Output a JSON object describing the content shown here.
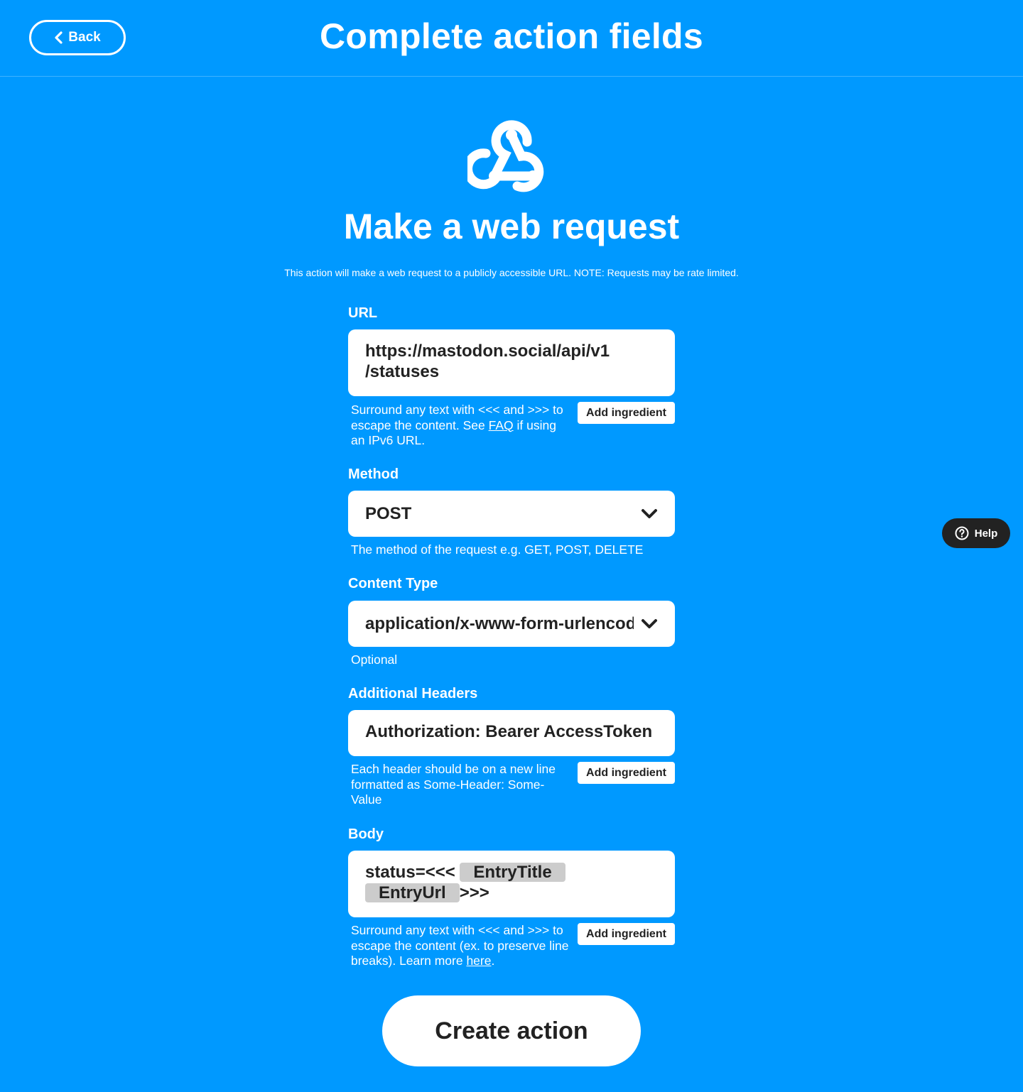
{
  "header": {
    "back_label": "Back",
    "title": "Complete action fields"
  },
  "service": {
    "icon": "webhooks-icon",
    "title": "Make a web request",
    "description": "This action will make a web request to a publicly accessible URL. NOTE: Requests may be rate limited."
  },
  "fields": {
    "url": {
      "label": "URL",
      "value_line1": "https://mastodon.social/api/v1",
      "value_line2": "/statuses",
      "help_part1": "Surround any text with <<< and >>> to escape the content. See ",
      "help_link": "FAQ",
      "help_part2": " if using an IPv6 URL.",
      "add_ingredient_label": "Add ingredient"
    },
    "method": {
      "label": "Method",
      "value": "POST",
      "help": "The method of the request e.g. GET, POST, DELETE"
    },
    "content_type": {
      "label": "Content Type",
      "value": "application/x-www-form-urlencoded",
      "help": "Optional"
    },
    "headers": {
      "label": "Additional Headers",
      "value": "Authorization: Bearer AccessToken",
      "help": "Each header should be on a new line formatted as Some-Header: Some-Value",
      "add_ingredient_label": "Add ingredient"
    },
    "body": {
      "label": "Body",
      "prefix": "status=<<< ",
      "ingredient1": "EntryTitle",
      "ingredient2": "EntryUrl",
      "suffix": ">>>",
      "help_part1": "Surround any text with <<< and >>> to escape the content (ex. to preserve line breaks). Learn more ",
      "help_link": "here",
      "help_part2": ".",
      "add_ingredient_label": "Add ingredient"
    }
  },
  "create_label": "Create action",
  "help_fab_label": "Help",
  "colors": {
    "background": "#0099ff",
    "ingredient_pill": "#cccccc",
    "help_fab": "#222222"
  }
}
